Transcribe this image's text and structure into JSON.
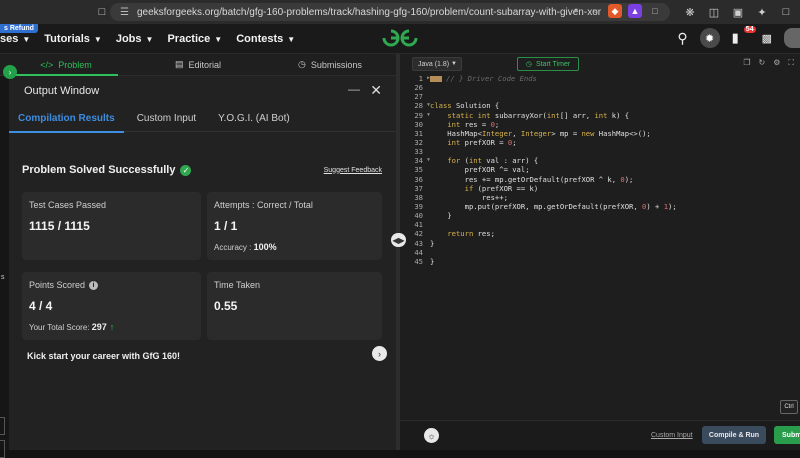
{
  "browser": {
    "url": "geeksforgeeks.org/batch/gfg-160-problems/track/hashing-gfg-160/problem/count-subarray-with-given-xor"
  },
  "header": {
    "badge": "s Refund",
    "nav": [
      {
        "label": "ses"
      },
      {
        "label": "Tutorials"
      },
      {
        "label": "Jobs"
      },
      {
        "label": "Practice"
      },
      {
        "label": "Contests"
      }
    ],
    "notifications": "54"
  },
  "left_tabs": {
    "problem": "Problem",
    "editorial": "Editorial",
    "submissions": "Submissions"
  },
  "output": {
    "title": "Output Window",
    "tabs": [
      "Compilation Results",
      "Custom Input",
      "Y.O.G.I. (AI Bot)"
    ],
    "status": "Problem Solved Successfully",
    "suggest": "Suggest Feedback",
    "test_cases_label": "Test Cases Passed",
    "test_cases_value": "1115 / 1115",
    "attempts_label": "Attempts : Correct / Total",
    "attempts_value": "1 / 1",
    "accuracy_label": "Accuracy :",
    "accuracy_value": "100%",
    "points_label": "Points Scored",
    "points_value": "4 / 4",
    "total_score_label": "Your Total Score:",
    "total_score_value": "297",
    "time_label": "Time Taken",
    "time_value": "0.55",
    "kick": "Kick start your career with GfG 160!"
  },
  "side": {
    "letter": "s"
  },
  "editor": {
    "language": "Java (1.8)",
    "timer": "Start Timer",
    "line_numbers": [
      "1",
      "26",
      "27",
      "28",
      "29",
      "30",
      "31",
      "32",
      "33",
      "34",
      "35",
      "36",
      "37",
      "38",
      "39",
      "40",
      "41",
      "42",
      "43",
      "44",
      "45"
    ],
    "custom_input": "Custom Input",
    "compile": "Compile & Run",
    "submit": "Subm",
    "ctrl": "Ctrl"
  }
}
